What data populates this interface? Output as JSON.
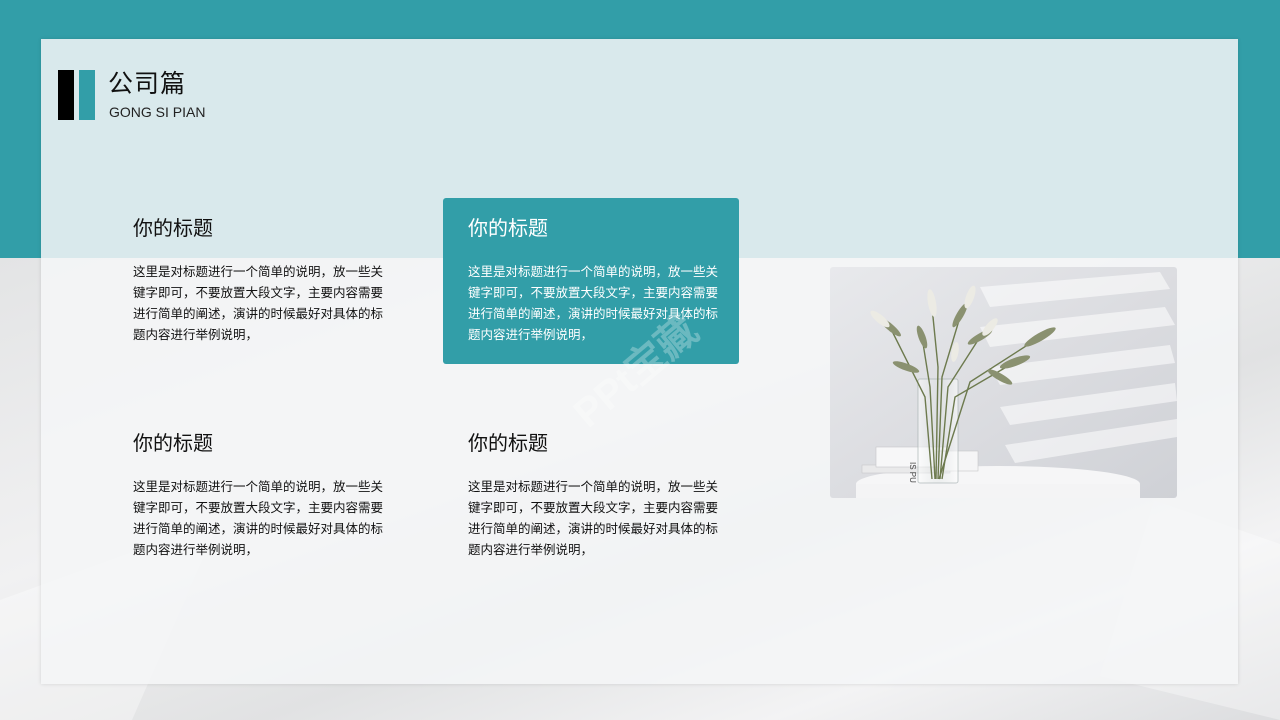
{
  "header": {
    "title": "公司篇",
    "subtitle": "GONG SI PIAN"
  },
  "cards": [
    {
      "title": "你的标题",
      "body": "这里是对标题进行一个简单的说明，放一些关键字即可，不要放置大段文字，主要内容需要进行简单的阐述，演讲的时候最好对具体的标题内容进行举例说明，"
    },
    {
      "title": "你的标题",
      "body": "这里是对标题进行一个简单的说明，放一些关键字即可，不要放置大段文字，主要内容需要进行简单的阐述，演讲的时候最好对具体的标题内容进行举例说明，"
    },
    {
      "title": "你的标题",
      "body": "这里是对标题进行一个简单的说明，放一些关键字即可，不要放置大段文字，主要内容需要进行简单的阐述，演讲的时候最好对具体的标题内容进行举例说明，"
    },
    {
      "title": "你的标题",
      "body": "这里是对标题进行一个简单的说明，放一些关键字即可，不要放置大段文字，主要内容需要进行简单的阐述，演讲的时候最好对具体的标题内容进行举例说明，"
    }
  ],
  "photo": {
    "book_text": "IS PU",
    "icon": "flower-vase-photo"
  },
  "watermark": "PPt宝藏",
  "colors": {
    "accent": "#329ea8",
    "logo_dark": "#000000",
    "panel": "#f5f6f7"
  }
}
